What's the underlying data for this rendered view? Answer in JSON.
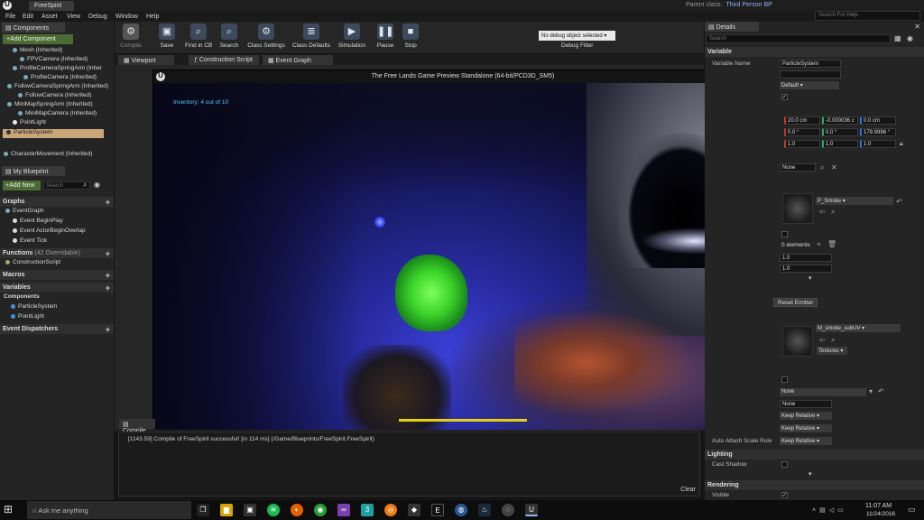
{
  "titlebar": {
    "doc_tab": "FreeSpirit",
    "parent_class_label": "Parent class:",
    "parent_class_value": "Third Person BP",
    "help_search_placeholder": "Search For Help"
  },
  "menu": [
    "File",
    "Edit",
    "Asset",
    "View",
    "Debug",
    "Window",
    "Help"
  ],
  "toolbar": {
    "buttons": [
      "Compile",
      "Save",
      "Find in CB",
      "Search",
      "Class Settings",
      "Class Defaults",
      "Simulation",
      "Pause",
      "Stop"
    ],
    "debug_select": "No debug object selected",
    "debug_filter": "Debug Filter"
  },
  "components": {
    "tab": "Components",
    "add_button": "+Add Component",
    "tree": [
      "Mesh (Inherited)",
      "FPVCamera (Inherited)",
      "ProfileCameraSpringArm (Inher",
      "ProfileCamera (Inherited)",
      "FollowCameraSpringArm (Inherited)",
      "FollowCamera (Inherited)",
      "MiniMapSpringArm (Inherited)",
      "MiniMapCamera (Inherited)",
      "PointLight",
      "ParticleSystem",
      "CharacterMovement (Inherited)"
    ]
  },
  "my_blueprint": {
    "tab": "My Blueprint",
    "add_new": "+Add New",
    "search_placeholder": "Search",
    "graphs_header": "Graphs",
    "graph_items": [
      "EventGraph",
      "Event BeginPlay",
      "Event ActorBeginOverlap",
      "Event Tick"
    ],
    "functions_header": "Functions",
    "functions_overridable": "(42 Overridable)",
    "function_items": [
      "ConstructionScript"
    ],
    "macros_header": "Macros",
    "variables_header": "Variables",
    "components_header": "Components",
    "component_vars": [
      "ParticleSystem",
      "PointLight"
    ],
    "dispatchers_header": "Event Dispatchers"
  },
  "center_tabs": [
    "Viewport",
    "Construction Script",
    "Event Graph"
  ],
  "game": {
    "title": "The Free Lands Game Preview Standalone (64-bit/PCD3D_SM5)",
    "inventory": "Inventory: 4 out of 10",
    "bar_fill_fraction": 1.0
  },
  "compiler": {
    "tab": "Compile",
    "log": "[1143.59] Compile of FreeSpirit successful! [in 114 ms] (/Game/Blueprints/FreeSpirit.FreeSpirit)",
    "clear": "Clear"
  },
  "details": {
    "tab": "Details",
    "search_placeholder": "Search",
    "variable_header": "Variable",
    "variable_name_label": "Variable Name",
    "variable_name_value": "ParticleSystem",
    "default_drop": "Default",
    "location": [
      "20.0 cm",
      "-0.000036 c",
      "0.0 cm"
    ],
    "rotation": [
      "0.0 °",
      "0.0 °",
      "179.9996 °"
    ],
    "scale": [
      "1.0",
      "1.0",
      "1.0"
    ],
    "none_value": "None",
    "template": "P_Smoke",
    "elements": "0 elements",
    "float_a": "1.0",
    "float_b": "1.0",
    "reset_emitter": "Reset Emitter",
    "material": "M_smoke_subUV",
    "textures": "Textures",
    "none_value2": "None",
    "none_value3": "None",
    "keep_relative": [
      "Keep Relative",
      "Keep Relative",
      "Keep Relative"
    ],
    "auto_attach_label": "Auto Attach Scale Rule",
    "lighting_header": "Lighting",
    "cast_shadow_label": "Cast Shadow",
    "rendering_header": "Rendering",
    "visible_label": "Visible"
  },
  "taskbar": {
    "search_placeholder": "Ask me anything",
    "time": "11:07 AM",
    "date": "11/24/2016"
  }
}
